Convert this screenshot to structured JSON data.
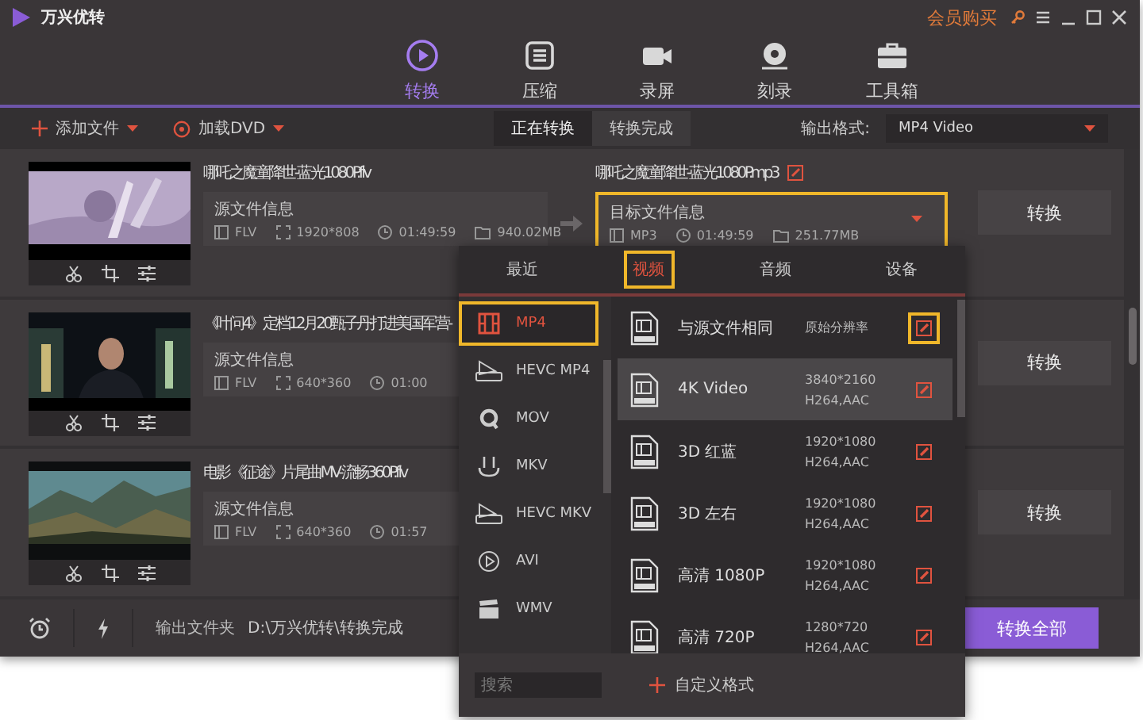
{
  "app": {
    "title": "万兴优转",
    "member": "会员购买"
  },
  "nav": [
    {
      "label": "转换",
      "kind": "convert",
      "selected": true
    },
    {
      "label": "压缩",
      "kind": "compress",
      "selected": false
    },
    {
      "label": "录屏",
      "kind": "record",
      "selected": false
    },
    {
      "label": "刻录",
      "kind": "burn",
      "selected": false
    },
    {
      "label": "工具箱",
      "kind": "toolbox",
      "selected": false
    }
  ],
  "toolbar": {
    "add_file": "添加文件",
    "load_dvd": "加载DVD",
    "segments": [
      {
        "label": "正在转换",
        "selected": true
      },
      {
        "label": "转换完成",
        "selected": false
      }
    ],
    "output_format_label": "输出格式:",
    "output_format": "MP4 Video"
  },
  "files": [
    {
      "name": "哪吒之魔童降世-蓝光1080P.flv",
      "source": {
        "heading": "源文件信息",
        "format": "FLV",
        "resolution": "1920*808",
        "duration": "01:49:59",
        "size": "940.02MB"
      },
      "target": {
        "name": "哪吒之魔童降世-蓝光1080P.mp3",
        "heading": "目标文件信息",
        "format": "MP3",
        "duration": "01:49:59",
        "size": "251.77MB",
        "highlighted": true
      },
      "convert": "转换"
    },
    {
      "name": "《叶问4》定档12月20甄子丹打进美国军营-",
      "source": {
        "heading": "源文件信息",
        "format": "FLV",
        "resolution": "640*360",
        "duration": "01:00"
      },
      "convert": "转换"
    },
    {
      "name": "电影《征途》片尾曲MV-流畅360P.flv",
      "source": {
        "heading": "源文件信息",
        "format": "FLV",
        "resolution": "640*360",
        "duration": "01:57"
      },
      "convert": "转换"
    }
  ],
  "bottom": {
    "output_folder_label": "输出文件夹",
    "output_path": "D:\\万兴优转\\转换完成",
    "convert_all": "转换全部"
  },
  "popup": {
    "tabs": [
      {
        "label": "最近",
        "selected": false,
        "highlighted": false
      },
      {
        "label": "视频",
        "selected": true,
        "highlighted": true
      },
      {
        "label": "音频",
        "selected": false,
        "highlighted": false
      },
      {
        "label": "设备",
        "selected": false,
        "highlighted": false
      }
    ],
    "formats": [
      {
        "label": "MP4",
        "kind": "film",
        "selected": true,
        "highlighted": true
      },
      {
        "label": "HEVC MP4",
        "kind": "hevc",
        "selected": false,
        "highlighted": false
      },
      {
        "label": "MOV",
        "kind": "q",
        "selected": false,
        "highlighted": false
      },
      {
        "label": "MKV",
        "kind": "mkv",
        "selected": false,
        "highlighted": false
      },
      {
        "label": "HEVC MKV",
        "kind": "hevc",
        "selected": false,
        "highlighted": false
      },
      {
        "label": "AVI",
        "kind": "play",
        "selected": false,
        "highlighted": false
      },
      {
        "label": "WMV",
        "kind": "clapper",
        "selected": false,
        "highlighted": false
      }
    ],
    "presets": [
      {
        "name": "与源文件相同",
        "specs": [
          "原始分辨率"
        ],
        "selected": false,
        "highlighted": true
      },
      {
        "name": "4K Video",
        "specs": [
          "3840*2160",
          "H264,AAC"
        ],
        "selected": true,
        "highlighted": false
      },
      {
        "name": "3D 红蓝",
        "specs": [
          "1920*1080",
          "H264,AAC"
        ],
        "selected": false,
        "highlighted": false
      },
      {
        "name": "3D 左右",
        "specs": [
          "1920*1080",
          "H264,AAC"
        ],
        "selected": false,
        "highlighted": false
      },
      {
        "name": "高清 1080P",
        "specs": [
          "1920*1080",
          "H264,AAC"
        ],
        "selected": false,
        "highlighted": false
      },
      {
        "name": "高清 720P",
        "specs": [
          "1280*720",
          "H264,AAC"
        ],
        "selected": false,
        "highlighted": false
      }
    ],
    "search_placeholder": "搜索",
    "custom_format": "自定义格式"
  }
}
